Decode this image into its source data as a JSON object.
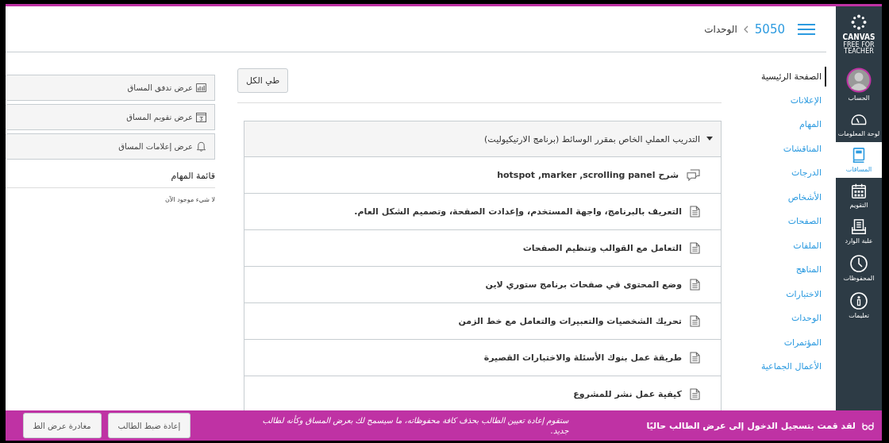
{
  "global_nav": {
    "logo": {
      "title": "CANVAS",
      "subtitle": "FREE FOR TEACHER"
    },
    "items": [
      {
        "kind": "account",
        "label": "الحساب",
        "selected": false
      },
      {
        "kind": "dashboard",
        "label": "لوحة المعلومات",
        "selected": false
      },
      {
        "kind": "courses",
        "label": "المساقات",
        "selected": true
      },
      {
        "kind": "calendar",
        "label": "التقويم",
        "selected": false
      },
      {
        "kind": "inbox",
        "label": "علبة الوارد",
        "selected": false
      },
      {
        "kind": "history",
        "label": "المحفوظات",
        "selected": false
      },
      {
        "kind": "help",
        "label": "تعليمات",
        "selected": false
      }
    ]
  },
  "header": {
    "breadcrumb": [
      {
        "kind": "link",
        "label": "5050"
      },
      {
        "kind": "current",
        "label": "الوحدات"
      }
    ]
  },
  "course_nav": [
    {
      "label": "الصفحة الرئيسية",
      "selected": true
    },
    {
      "label": "الإعلانات",
      "selected": false
    },
    {
      "label": "المهام",
      "selected": false
    },
    {
      "label": "المناقشات",
      "selected": false
    },
    {
      "label": "الدرجات",
      "selected": false
    },
    {
      "label": "الأشخاص",
      "selected": false
    },
    {
      "label": "الصفحات",
      "selected": false
    },
    {
      "label": "الملفات",
      "selected": false
    },
    {
      "label": "المناهج",
      "selected": false
    },
    {
      "label": "الاختبارات",
      "selected": false
    },
    {
      "label": "الوحدات",
      "selected": false
    },
    {
      "label": "المؤتمرات",
      "selected": false
    },
    {
      "label": "الأعمال الجماعية",
      "selected": false
    }
  ],
  "collapse_button": "طي الكل",
  "module": {
    "title": "التدريب العملي الخاص بمقرر الوسائط (برنامج الارتيكيوليت)",
    "expanded": true,
    "items": [
      {
        "kind": "discussion",
        "title": "شرح hotspot ,marker ,scrolling panel"
      },
      {
        "kind": "page",
        "title": "التعريف بالبرنامج، واجهة المستخدم، وإعدادت الصفحة، وتصميم الشكل العام."
      },
      {
        "kind": "page",
        "title": "التعامل مع القوالب وتنظيم الصفحات"
      },
      {
        "kind": "page",
        "title": "وضع المحتوى في صفحات برنامج ستوري لاين"
      },
      {
        "kind": "page",
        "title": "تحريك الشخصيات والتعبيرات والتعامل مع خط الزمن"
      },
      {
        "kind": "page",
        "title": "طريقة عمل بنوك الأسئلة والاختبارات القصيرة"
      },
      {
        "kind": "page",
        "title": "كيفية عمل نشر للمشروع"
      }
    ]
  },
  "sidebar": {
    "buttons": [
      {
        "kind": "stream",
        "label": "عرض تدفق المساق"
      },
      {
        "kind": "calendar",
        "label": "عرض تقويم المساق"
      },
      {
        "kind": "notifications",
        "label": "عرض إعلامات المساق"
      }
    ],
    "todo": {
      "title": "قائمة المهام",
      "empty": "لا شيء موجود الآن"
    }
  },
  "student_view_bar": {
    "message": "لقد قمت بتسجيل الدخول إلى عرض الطالب حاليًا",
    "note": "ستقوم إعادة تعيين الطالب بحذف كافة محفوظاته، ما سيسمح لك بعرض المساق وكأنه لطالب جديد.",
    "buttons": [
      "إعادة ضبط الطالب",
      "مغادرة عرض الط"
    ]
  }
}
